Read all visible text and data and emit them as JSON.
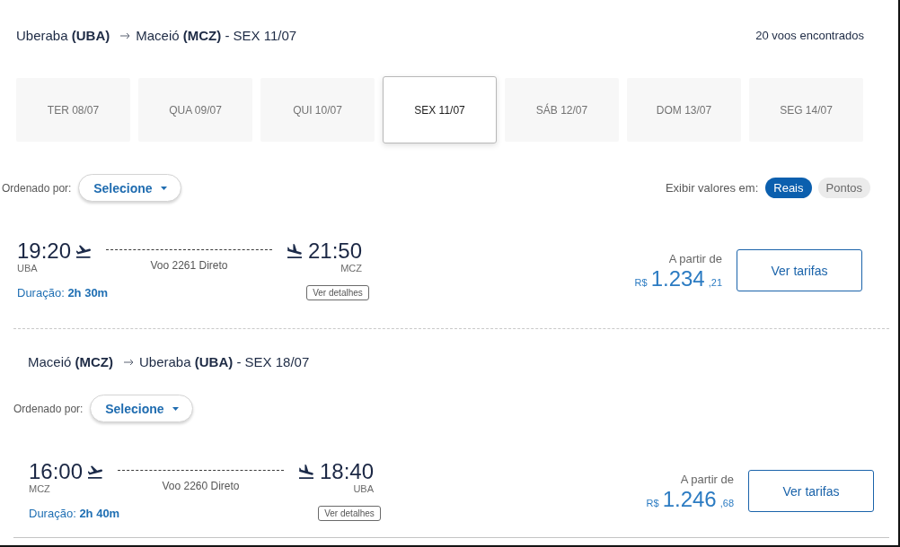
{
  "sections": [
    {
      "origin": "Uberaba **(UBA)**",
      "destination": "Maceió **(MCZ)** - SEX 11/07",
      "results_count": "20 voos encontrados",
      "date_tabs": [
        {
          "label": "TER 08/07",
          "selected": false
        },
        {
          "label": "QUA 09/07",
          "selected": false
        },
        {
          "label": "QUI 10/07",
          "selected": false
        },
        {
          "label": "SEX 11/07",
          "selected": true
        },
        {
          "label": "SÁB 12/07",
          "selected": false
        },
        {
          "label": "DOM 13/07",
          "selected": false
        },
        {
          "label": "SEG 14/07",
          "selected": false
        }
      ],
      "sort": {
        "label": "Ordenado por:",
        "value": "Selecione"
      },
      "currency_toggle": {
        "label": "Exibir valores em:",
        "options": [
          {
            "label": "Reais",
            "selected": true
          },
          {
            "label": "Pontos",
            "selected": false
          }
        ]
      },
      "flights": [
        {
          "departure_time": "19:20",
          "departure_airport": "UBA",
          "flight_info": "Voo 2261 Direto",
          "arrival_time": "21:50",
          "arrival_airport": "MCZ",
          "duration": "Duração: **2h 30m**",
          "details_button": "Ver detalhes",
          "price_label": "A partir de",
          "price_currency": "R$",
          "price_amount": "1.234",
          "price_cents": ",21",
          "fares_button": "Ver tarifas"
        }
      ]
    },
    {
      "origin": "Maceió **(MCZ)**",
      "destination": "Uberaba **(UBA)** - SEX 18/07",
      "sort": {
        "label": "Ordenado por:",
        "value": "Selecione"
      },
      "flights": [
        {
          "departure_time": "16:00",
          "departure_airport": "MCZ",
          "flight_info": "Voo 2260 Direto",
          "arrival_time": "18:40",
          "arrival_airport": "UBA",
          "duration": "Duração: **2h 40m**",
          "details_button": "Ver detalhes",
          "price_label": "A partir de",
          "price_currency": "R$",
          "price_amount": "1.246",
          "price_cents": ",68",
          "fares_button": "Ver tarifas"
        }
      ]
    }
  ]
}
